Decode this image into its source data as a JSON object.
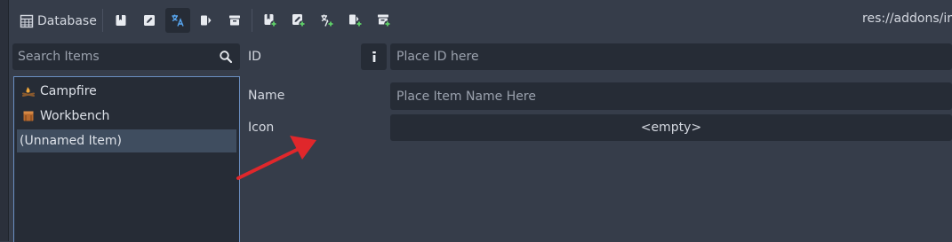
{
  "toolbar": {
    "database_label": "Database",
    "path": "res://addons/ir",
    "buttons": [
      {
        "icon": "bookmark-icon",
        "active": false
      },
      {
        "icon": "edit-icon",
        "active": false
      },
      {
        "icon": "translation-icon",
        "active": true
      },
      {
        "icon": "export-icon",
        "active": false
      },
      {
        "icon": "archive-icon",
        "active": false
      },
      {
        "icon": "add-bookmark-icon",
        "active": false
      },
      {
        "icon": "add-edit-icon",
        "active": false
      },
      {
        "icon": "add-translation-icon",
        "active": false
      },
      {
        "icon": "add-export-icon",
        "active": false
      },
      {
        "icon": "add-archive-icon",
        "active": false
      }
    ]
  },
  "sidebar": {
    "search_placeholder": "Search Items",
    "items": [
      {
        "label": "Campfire",
        "icon": "campfire-icon",
        "selected": false
      },
      {
        "label": "Workbench",
        "icon": "workbench-icon",
        "selected": false
      },
      {
        "label": "(Unnamed Item)",
        "icon": "",
        "selected": true
      }
    ]
  },
  "main": {
    "id_label": "ID",
    "id_placeholder": "Place ID here",
    "name_label": "Name",
    "name_placeholder": "Place Item Name Here",
    "icon_label": "Icon",
    "icon_value": "<empty>"
  },
  "colors": {
    "accent": "#6b8fc2",
    "green": "#5fd068",
    "arrow": "#e0272b"
  }
}
